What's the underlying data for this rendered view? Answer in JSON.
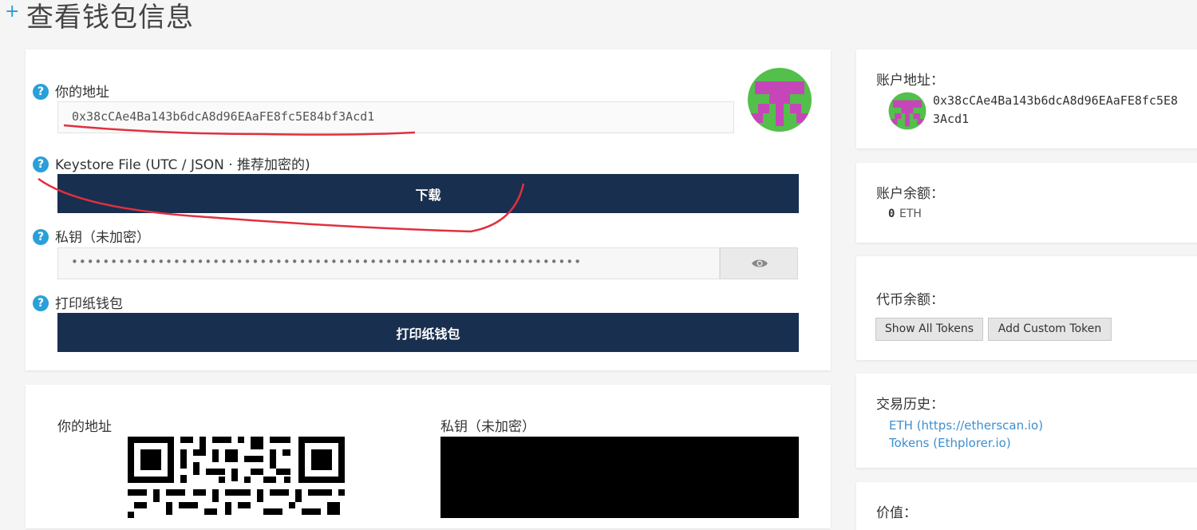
{
  "page": {
    "title": "查看钱包信息",
    "plus": "+"
  },
  "wallet": {
    "address_label": "你的地址",
    "address": "0x38cCAe4Ba143b6dcA8d96EAaFE8fc5E84bf3Acd1",
    "keystore_label": "Keystore File (UTC / JSON · 推荐加密的)",
    "download_label": "下载",
    "privkey_label": "私钥（未加密）",
    "privkey_masked": "•••••••••••••••••••••••••••••••••••••••••••••••••••••••••••••••••",
    "print_label": "打印纸钱包",
    "print_button": "打印纸钱包",
    "help_glyph": "?"
  },
  "qr": {
    "address_label": "你的地址",
    "privkey_label": "私钥（未加密）"
  },
  "sidebar": {
    "account_address_label": "账户地址：",
    "account_address_line1": "0x38cCAe4Ba143b6dcA8d96EAaFE8fc5E8",
    "account_address_line2": "3Acd1",
    "balance_label": "账户余额：",
    "balance_value": "0",
    "balance_unit": "ETH",
    "token_label": "代币余额：",
    "show_tokens": "Show All Tokens",
    "add_token": "Add Custom Token",
    "history_label": "交易历史：",
    "history_links": [
      "ETH (https://etherscan.io)",
      "Tokens (Ethplorer.io)"
    ],
    "value_label": "价值："
  },
  "colors": {
    "accent": "#2aa0d8",
    "button_dark": "#192f4f",
    "link": "#3d8fd0",
    "annotation": "#e03040"
  },
  "icons": {
    "help": "help-icon",
    "eye": "eye-icon",
    "identicon": "identicon"
  }
}
